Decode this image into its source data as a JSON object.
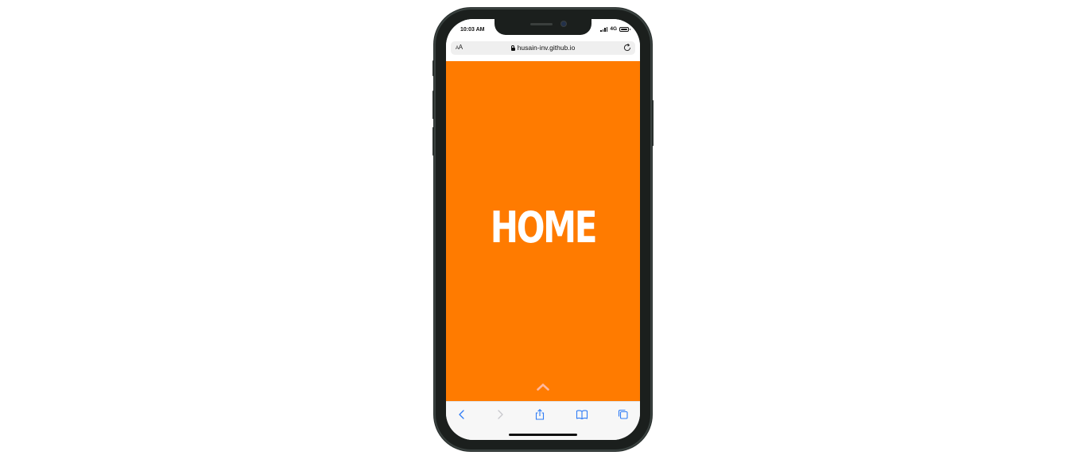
{
  "status_bar": {
    "time": "10:03 AM",
    "network": "4G"
  },
  "address_bar": {
    "text_size_small": "A",
    "text_size_large": "A",
    "url": "husain-inv.github.io"
  },
  "page": {
    "heading": "HOME",
    "background_color": "#ff7b00",
    "heading_color": "#ffffff"
  },
  "toolbar": {
    "items": [
      "back-icon",
      "forward-icon",
      "share-icon",
      "bookmarks-icon",
      "tabs-icon"
    ],
    "accent_color": "#2f7cf6"
  }
}
